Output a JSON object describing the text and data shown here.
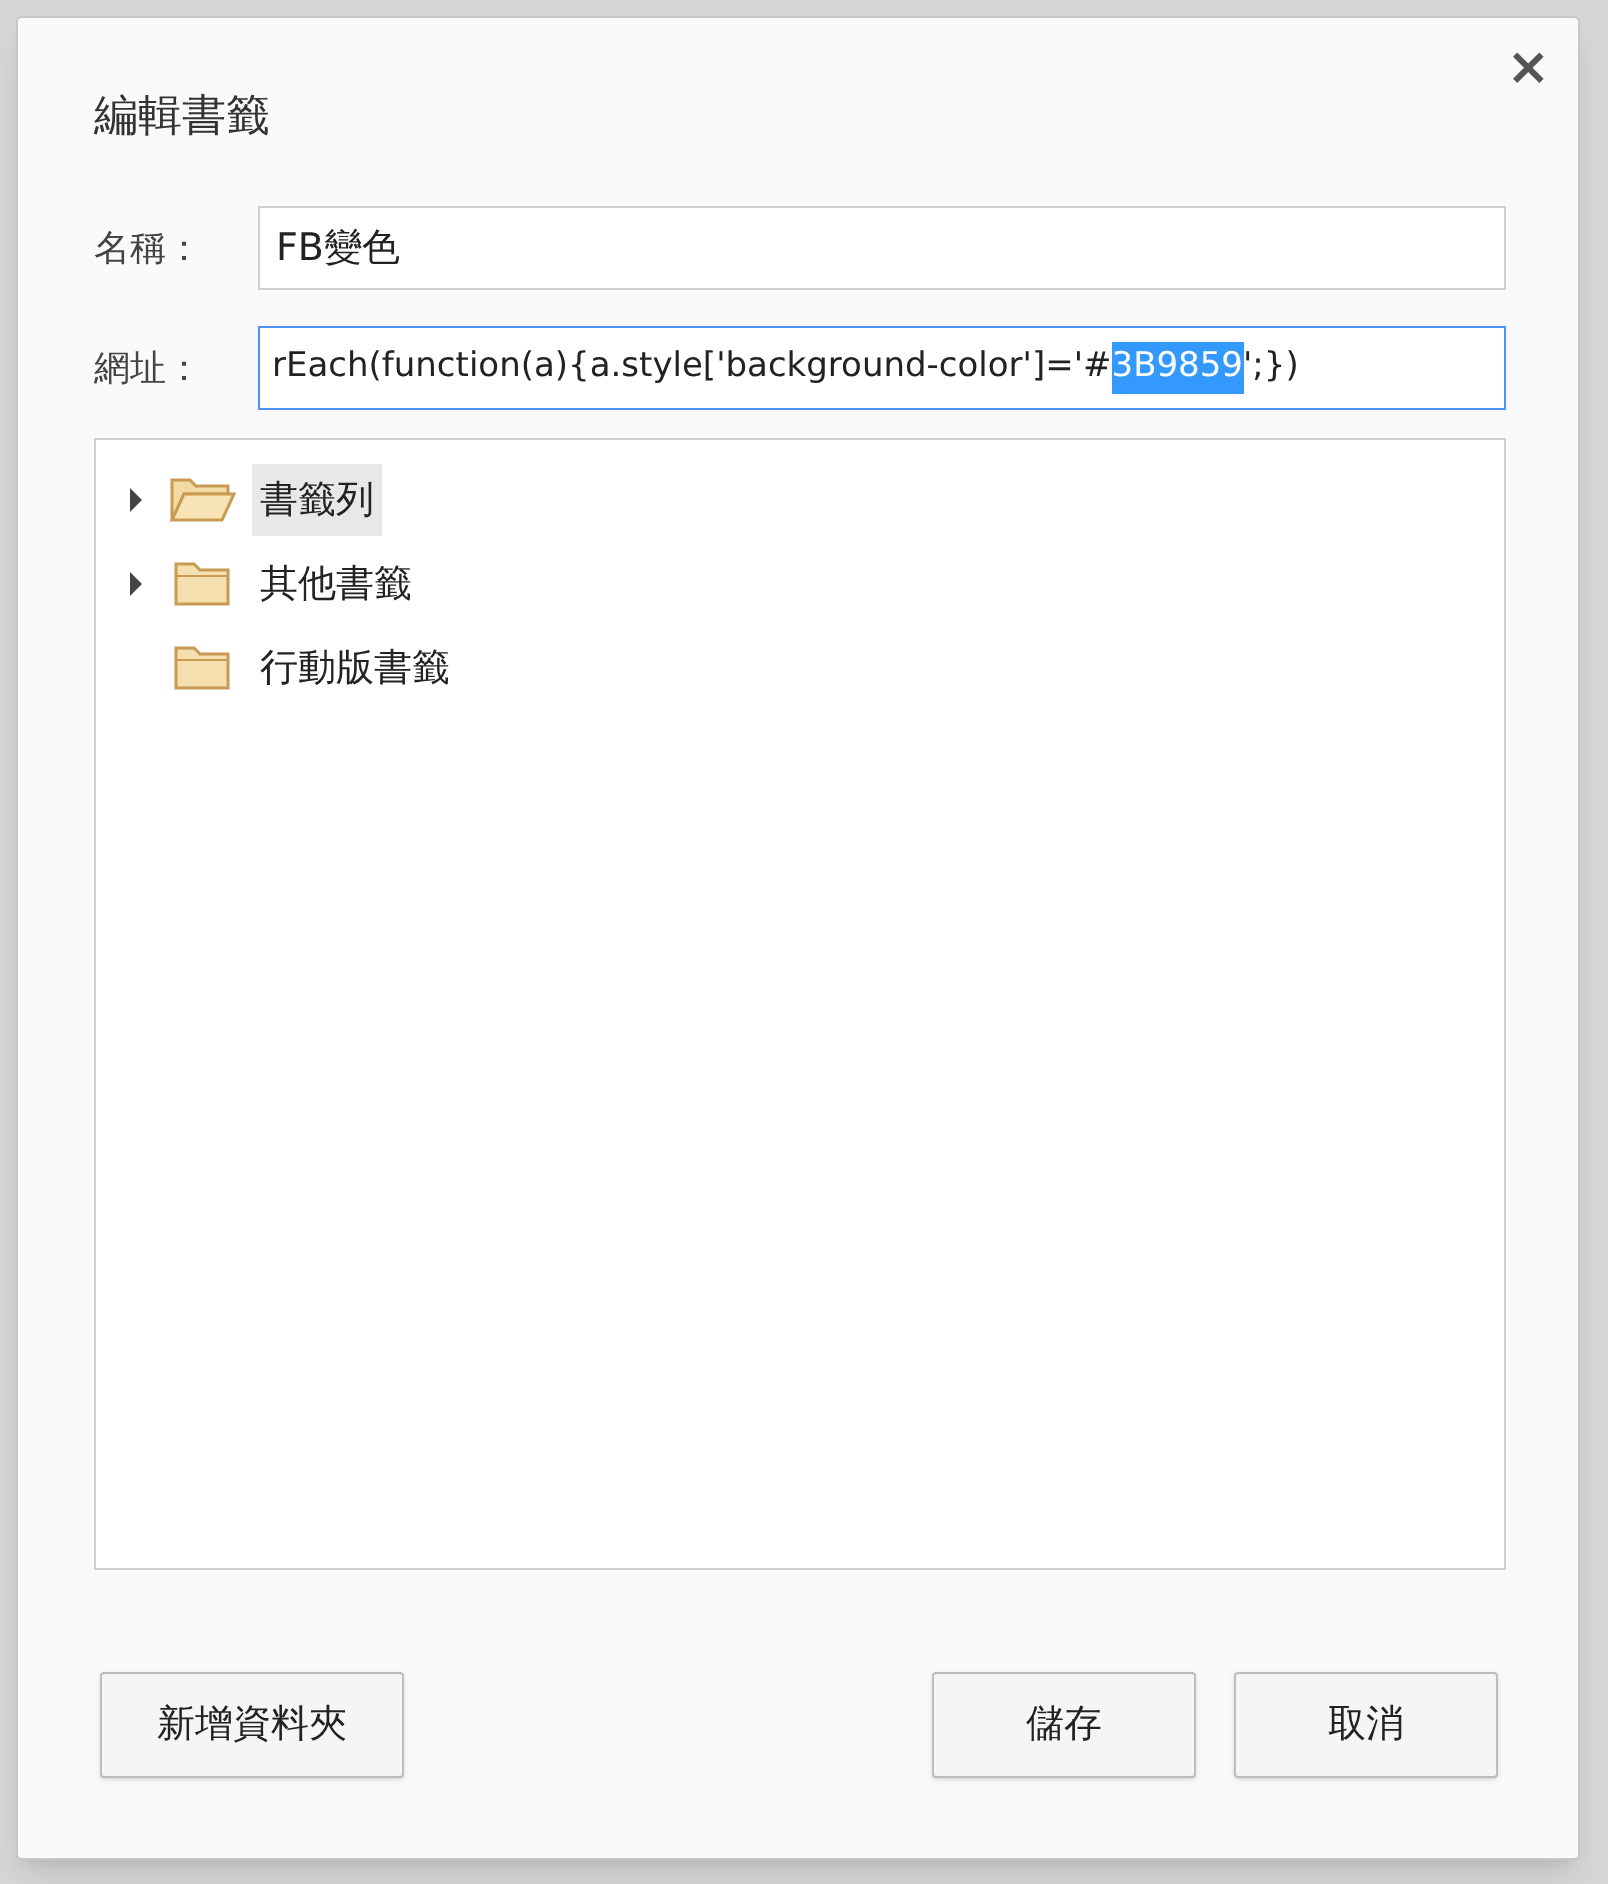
{
  "dialog": {
    "title": "編輯書籤",
    "close": "×"
  },
  "name_field": {
    "label": "名稱：",
    "value": "FB變色"
  },
  "url_field": {
    "label": "網址：",
    "value_before": "rEach(function(a){a.style['background-color']='#",
    "value_selected": "3B9859",
    "value_after": "';})",
    "focused": true
  },
  "folders": [
    {
      "label": "書籤列",
      "has_children": true,
      "selected": true
    },
    {
      "label": "其他書籤",
      "has_children": true,
      "selected": false
    },
    {
      "label": "行動版書籤",
      "has_children": false,
      "selected": false
    }
  ],
  "buttons": [
    {
      "label": "新增資料夾",
      "kind": "left"
    },
    {
      "label": "儲存",
      "kind": "right"
    },
    {
      "label": "取消",
      "kind": "right"
    }
  ]
}
